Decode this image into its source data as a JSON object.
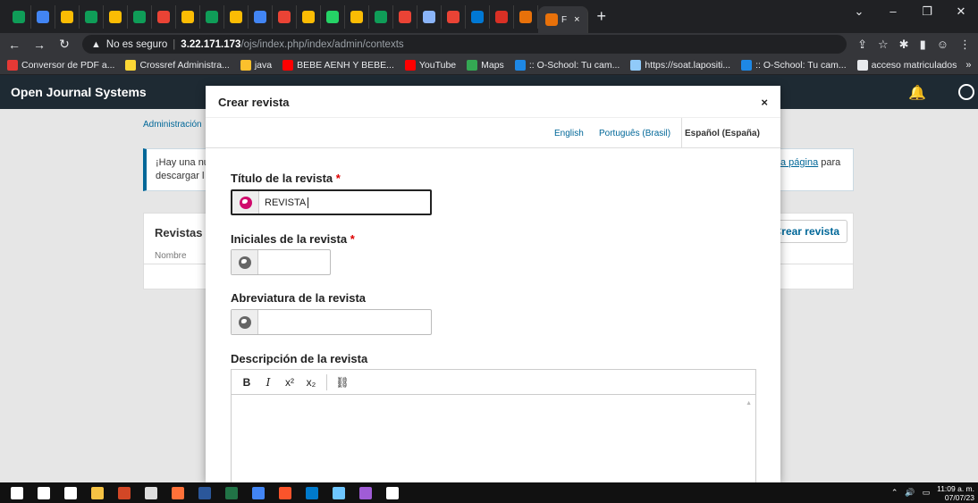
{
  "browser": {
    "tabs": [
      {
        "icon": "sheets-icon",
        "color": "#0f9d58"
      },
      {
        "icon": "chrome-icon",
        "color": "#4285f4"
      },
      {
        "icon": "drive-icon",
        "color": "#fbbc04"
      },
      {
        "icon": "sheets-icon",
        "color": "#0f9d58"
      },
      {
        "icon": "drive-icon",
        "color": "#fbbc04"
      },
      {
        "icon": "sheets-icon",
        "color": "#0f9d58"
      },
      {
        "icon": "gmail-icon",
        "color": "#ea4335"
      },
      {
        "icon": "drive-icon",
        "color": "#fbbc04"
      },
      {
        "icon": "sheets-icon",
        "color": "#0f9d58"
      },
      {
        "icon": "drive-icon",
        "color": "#fbbc04"
      },
      {
        "icon": "chrome-icon",
        "color": "#4285f4"
      },
      {
        "icon": "gmail-icon",
        "color": "#ea4335"
      },
      {
        "icon": "drive-icon",
        "color": "#fbbc04"
      },
      {
        "icon": "whatsapp-icon",
        "color": "#25d366"
      },
      {
        "icon": "drive-icon",
        "color": "#fbbc04"
      },
      {
        "icon": "sheets-icon",
        "color": "#0f9d58"
      },
      {
        "icon": "gmail-icon",
        "color": "#ea4335"
      },
      {
        "icon": "app-icon",
        "color": "#8ab4f8"
      },
      {
        "icon": "gmail-icon",
        "color": "#ea4335"
      },
      {
        "icon": "outlook-icon",
        "color": "#0078d4"
      },
      {
        "icon": "pdf-icon",
        "color": "#d93025"
      },
      {
        "icon": "ojs-icon",
        "color": "#e8710a"
      }
    ],
    "active_tab_label": "F",
    "active_tab_close": "×",
    "new_tab": "+",
    "window_controls": [
      "⌄",
      "–",
      "❐",
      "✕"
    ],
    "security_label": "No es seguro",
    "url_host": "3.22.171.173",
    "url_path": "/ojs/index.php/index/admin/contexts",
    "bookmarks": [
      {
        "label": "Conversor de PDF a...",
        "color": "#e53935"
      },
      {
        "label": "Crossref Administra...",
        "color": "#fdd835"
      },
      {
        "label": "java",
        "color": "#fbc02d"
      },
      {
        "label": "BEBE AENH Y BEBE...",
        "color": "#ff0000"
      },
      {
        "label": "YouTube",
        "color": "#ff0000"
      },
      {
        "label": "Maps",
        "color": "#34a853"
      },
      {
        "label": ":: O-School: Tu cam...",
        "color": "#1e88e5"
      },
      {
        "label": "https://soat.lapositi...",
        "color": "#90caf9"
      },
      {
        "label": ":: O-School: Tu cam...",
        "color": "#1e88e5"
      },
      {
        "label": "acceso matriculados",
        "color": "#e8eaed"
      }
    ],
    "bookmarks_more": "»"
  },
  "ojs": {
    "brand": "Open Journal Systems",
    "breadcrumb": "Administración",
    "notice_left": "¡Hay una nu",
    "notice_left2": "descargar l",
    "notice_link": "a página",
    "notice_after_link": " para",
    "panel_title": "Revistas",
    "column_name": "Nombre",
    "create_button": "Crear revista"
  },
  "modal": {
    "title": "Crear revista",
    "close": "×",
    "locales": [
      "English",
      "Português (Brasil)"
    ],
    "active_locale": "Español (España)",
    "fields": {
      "title_label": "Título de la revista",
      "title_value": "REVISTA",
      "initials_label": "Iniciales de la revista",
      "abbrev_label": "Abreviatura de la revista",
      "description_label": "Descripción de la revista"
    },
    "required_mark": "*",
    "editor_toolbar": [
      "B",
      "I",
      "x²",
      "x₂",
      "🔗"
    ]
  },
  "taskbar": {
    "clock_time": "11:09 a. m.",
    "clock_date": "07/07/23",
    "apps": [
      {
        "icon": "windows-start-icon",
        "color": "#ffffff"
      },
      {
        "icon": "search-icon",
        "color": "#ffffff"
      },
      {
        "icon": "task-view-icon",
        "color": "#ffffff"
      },
      {
        "icon": "file-explorer-icon",
        "color": "#f6c344"
      },
      {
        "icon": "powerpoint-icon",
        "color": "#d24726"
      },
      {
        "icon": "calculator-icon",
        "color": "#dddddd"
      },
      {
        "icon": "firefox-icon",
        "color": "#ff7139"
      },
      {
        "icon": "word-icon",
        "color": "#2b579a"
      },
      {
        "icon": "excel-icon",
        "color": "#217346"
      },
      {
        "icon": "chrome-icon",
        "color": "#4285f4"
      },
      {
        "icon": "brave-icon",
        "color": "#fb542b"
      },
      {
        "icon": "vscode-icon",
        "color": "#007acc"
      },
      {
        "icon": "photos-icon",
        "color": "#6ec6ff"
      },
      {
        "icon": "app-icon",
        "color": "#a05cd6"
      },
      {
        "icon": "notepad-icon",
        "color": "#ffffff"
      }
    ]
  }
}
